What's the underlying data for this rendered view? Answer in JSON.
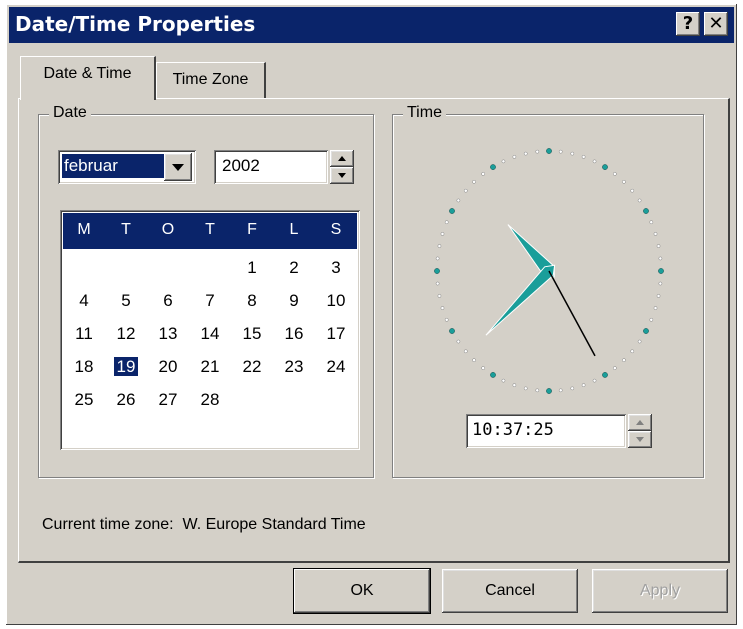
{
  "window": {
    "title": "Date/Time Properties",
    "help_label": "?",
    "close_label": "✕"
  },
  "tabs": [
    {
      "label": "Date & Time"
    },
    {
      "label": "Time Zone"
    }
  ],
  "date": {
    "group_label": "Date",
    "month": "februar",
    "year": "2002",
    "weekday_headers": [
      "M",
      "T",
      "O",
      "T",
      "F",
      "L",
      "S"
    ],
    "weeks": [
      [
        "",
        "",
        "",
        "",
        "1",
        "2",
        "3"
      ],
      [
        "4",
        "5",
        "6",
        "7",
        "8",
        "9",
        "10"
      ],
      [
        "11",
        "12",
        "13",
        "14",
        "15",
        "16",
        "17"
      ],
      [
        "18",
        "19",
        "20",
        "21",
        "22",
        "23",
        "24"
      ],
      [
        "25",
        "26",
        "27",
        "28",
        "",
        "",
        ""
      ]
    ],
    "selected_day": "19"
  },
  "time": {
    "group_label": "Time",
    "value": "10:37:25",
    "hour": 10,
    "minute": 37,
    "second": 25
  },
  "timezone": {
    "label": "Current time zone:",
    "value": "W. Europe Standard Time"
  },
  "buttons": {
    "ok": "OK",
    "cancel": "Cancel",
    "apply": "Apply"
  },
  "colors": {
    "titlebar": "#0a246a",
    "face": "#d4d0c8",
    "clock_hand": "#1a9e9a",
    "selection": "#0a246a",
    "disabled_text": "#a0a0a0"
  }
}
